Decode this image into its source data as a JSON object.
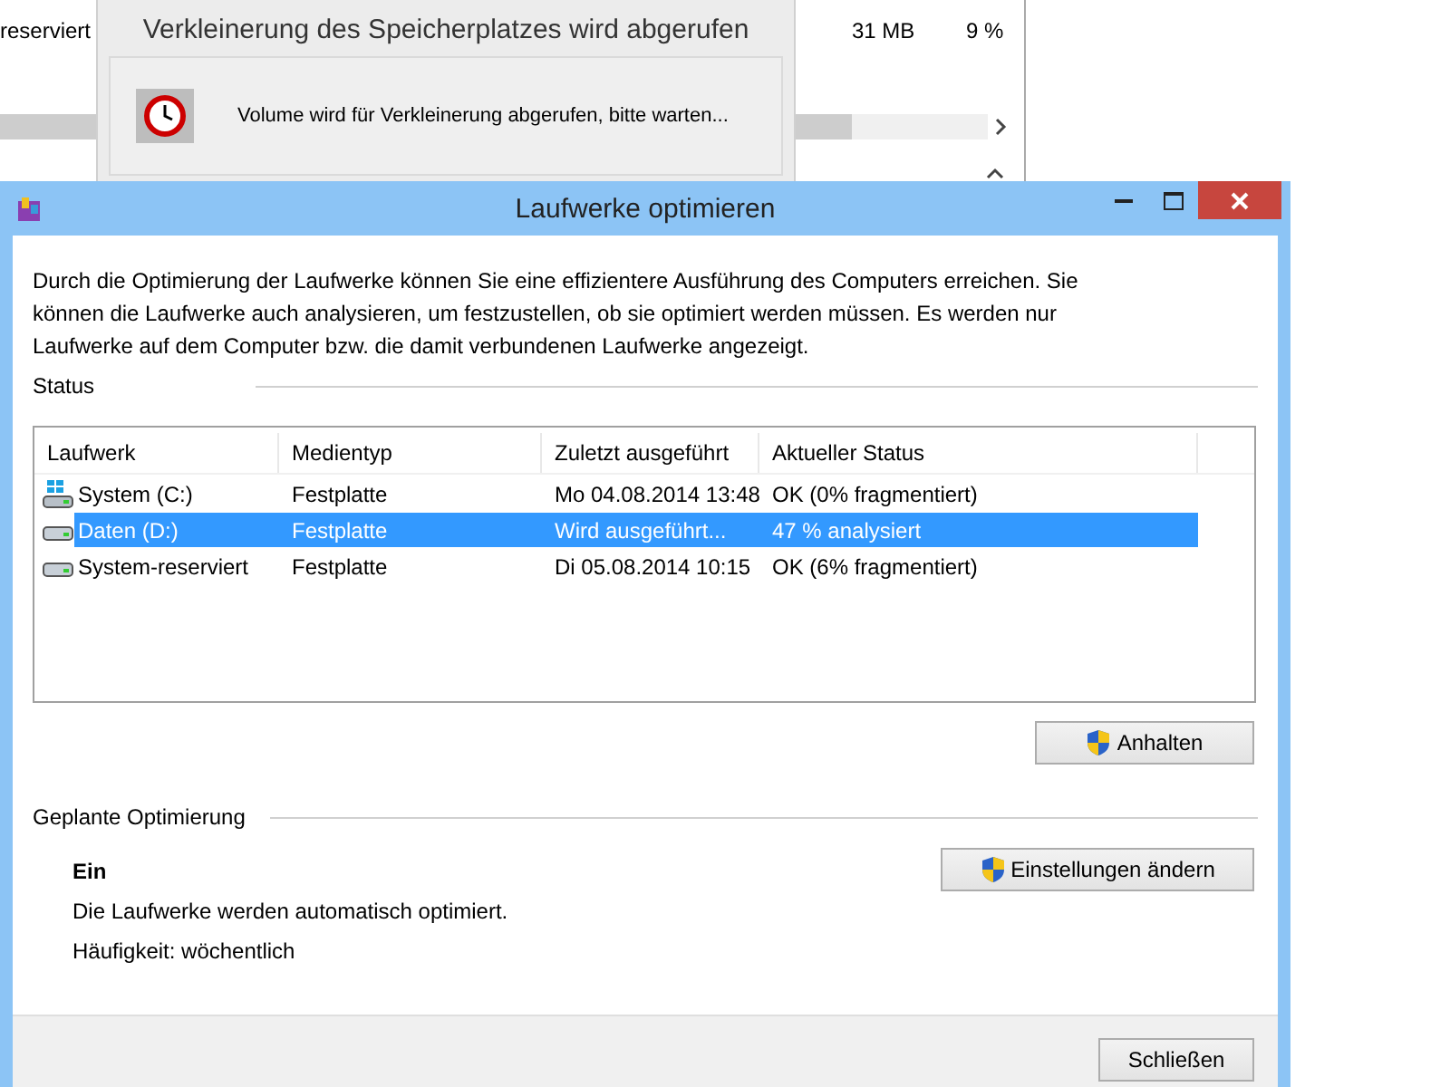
{
  "background_window": {
    "cells": [
      "reserviert",
      "31 MB",
      "9 %"
    ]
  },
  "progress_dialog": {
    "title": "Verkleinerung des Speicherplatzes wird abgerufen",
    "message": "Volume wird für Verkleinerung abgerufen, bitte warten..."
  },
  "window": {
    "title": "Laufwerke optimieren",
    "description": "Durch die Optimierung der Laufwerke können Sie eine effizientere Ausführung des Computers erreichen. Sie können die Laufwerke auch analysieren, um festzustellen, ob sie optimiert werden müssen. Es werden nur Laufwerke auf dem Computer bzw. die damit verbundenen Laufwerke angezeigt."
  },
  "status": {
    "label": "Status",
    "columns": [
      "Laufwerk",
      "Medientyp",
      "Zuletzt ausgeführt",
      "Aktueller Status"
    ],
    "rows": [
      {
        "kind": "system",
        "cells": [
          "System (C:)",
          "Festplatte",
          "Mo 04.08.2014 13:48",
          "OK (0% fragmentiert)"
        ],
        "selected": false
      },
      {
        "kind": "disk",
        "cells": [
          "Daten (D:)",
          "Festplatte",
          "Wird ausgeführt...",
          "47 % analysiert"
        ],
        "selected": true
      },
      {
        "kind": "disk",
        "cells": [
          "System-reserviert",
          "Festplatte",
          "Di 05.08.2014 10:15",
          "OK (6% fragmentiert)"
        ],
        "selected": false
      }
    ],
    "button": "Anhalten"
  },
  "schedule": {
    "label": "Geplante Optimierung",
    "state": "Ein",
    "button": "Einstellungen ändern",
    "lines": [
      "Die Laufwerke werden automatisch optimiert.",
      "Häufigkeit: wöchentlich"
    ]
  },
  "footer": {
    "button": "Schließen"
  }
}
